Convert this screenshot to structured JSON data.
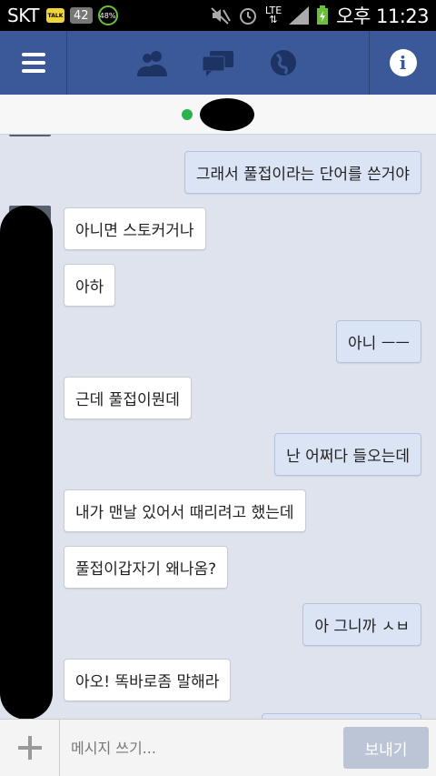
{
  "status_bar": {
    "carrier": "SKT",
    "talk_icon": "talk-app-icon",
    "notification_count": "42",
    "battery_indicator": "48%",
    "network": "LTE",
    "time": "오후 11:23"
  },
  "header": {
    "menu_icon": "hamburger-menu-icon",
    "icons": [
      "friends-icon",
      "messages-icon",
      "globe-icon"
    ],
    "info_icon": "info-icon"
  },
  "contact": {
    "status": "online",
    "status_color": "#2bb34b"
  },
  "messages": [
    {
      "sender": "me",
      "text": "그래서 풀접이라는 단어를 쓴거야"
    },
    {
      "sender": "them",
      "text": "아니면 스토커거나"
    },
    {
      "sender": "them",
      "text": "아하"
    },
    {
      "sender": "me",
      "text": "아니 ㅡㅡ"
    },
    {
      "sender": "them",
      "text": "근데 풀접이뭔데"
    },
    {
      "sender": "me",
      "text": "난 어쩌다 들오는데"
    },
    {
      "sender": "them",
      "text": "내가 맨날 있어서 때리려고 했는데"
    },
    {
      "sender": "them",
      "text": "풀접이갑자기 왜나옴?"
    },
    {
      "sender": "me",
      "text": "아 그니까 ㅅㅂ"
    },
    {
      "sender": "them",
      "text": "아오! 똑바로좀 말해라"
    }
  ],
  "input": {
    "placeholder": "메시지 쓰기...",
    "send_label": "보내기",
    "add_icon": "plus-icon"
  },
  "colors": {
    "header_bg": "#3b5998",
    "my_bubble": "#dbe4f4",
    "their_bubble": "#ffffff",
    "chat_bg": "#dfe3ee"
  }
}
